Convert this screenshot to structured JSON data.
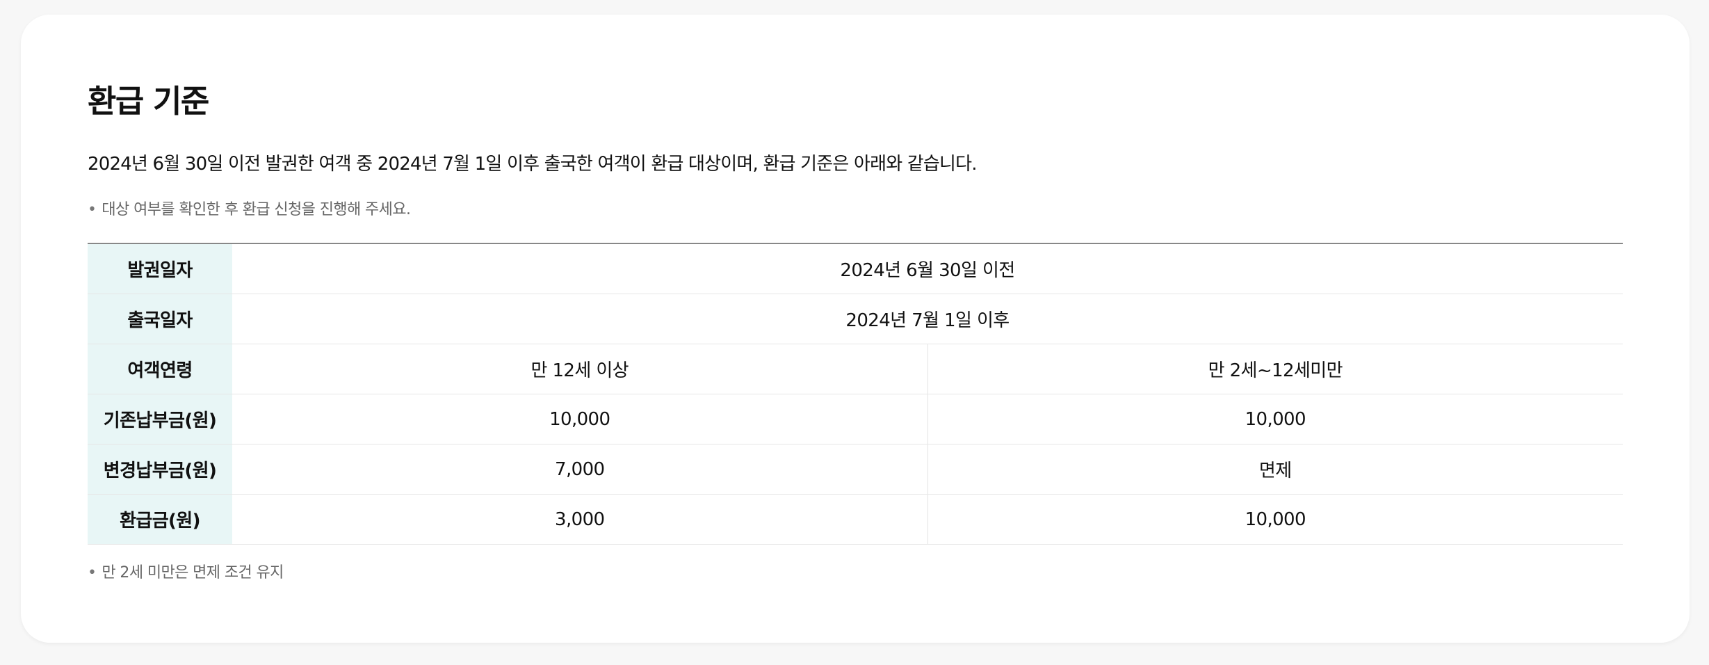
{
  "section": {
    "title": "환급 기준",
    "intro": "2024년 6월 30일 이전 발권한 여객 중 2024년 7월 1일 이후 출국한 여객이 환급 대상이며, 환급 기준은 아래와 같습니다.",
    "note_top": "대상 여부를 확인한 후 환급 신청을 진행해 주세요.",
    "note_bottom": "만 2세 미만은 면제 조건 유지",
    "bullet": "•"
  },
  "table": {
    "rows": [
      {
        "label": "발권일자",
        "value": "2024년 6월 30일 이전"
      },
      {
        "label": "출국일자",
        "value": "2024년 7월 1일 이후"
      },
      {
        "label": "여객연령",
        "col1": "만 12세 이상",
        "col2": "만 2세~12세미만"
      },
      {
        "label": "기존납부금(원)",
        "col1": "10,000",
        "col2": "10,000"
      },
      {
        "label": "변경납부금(원)",
        "col1": "7,000",
        "col2": "면제"
      },
      {
        "label": "환급금(원)",
        "col1": "3,000",
        "col2": "10,000"
      }
    ]
  },
  "colors": {
    "header_bg": "#e8f6f6",
    "card_bg": "#ffffff",
    "page_bg": "#f7f7f7"
  }
}
